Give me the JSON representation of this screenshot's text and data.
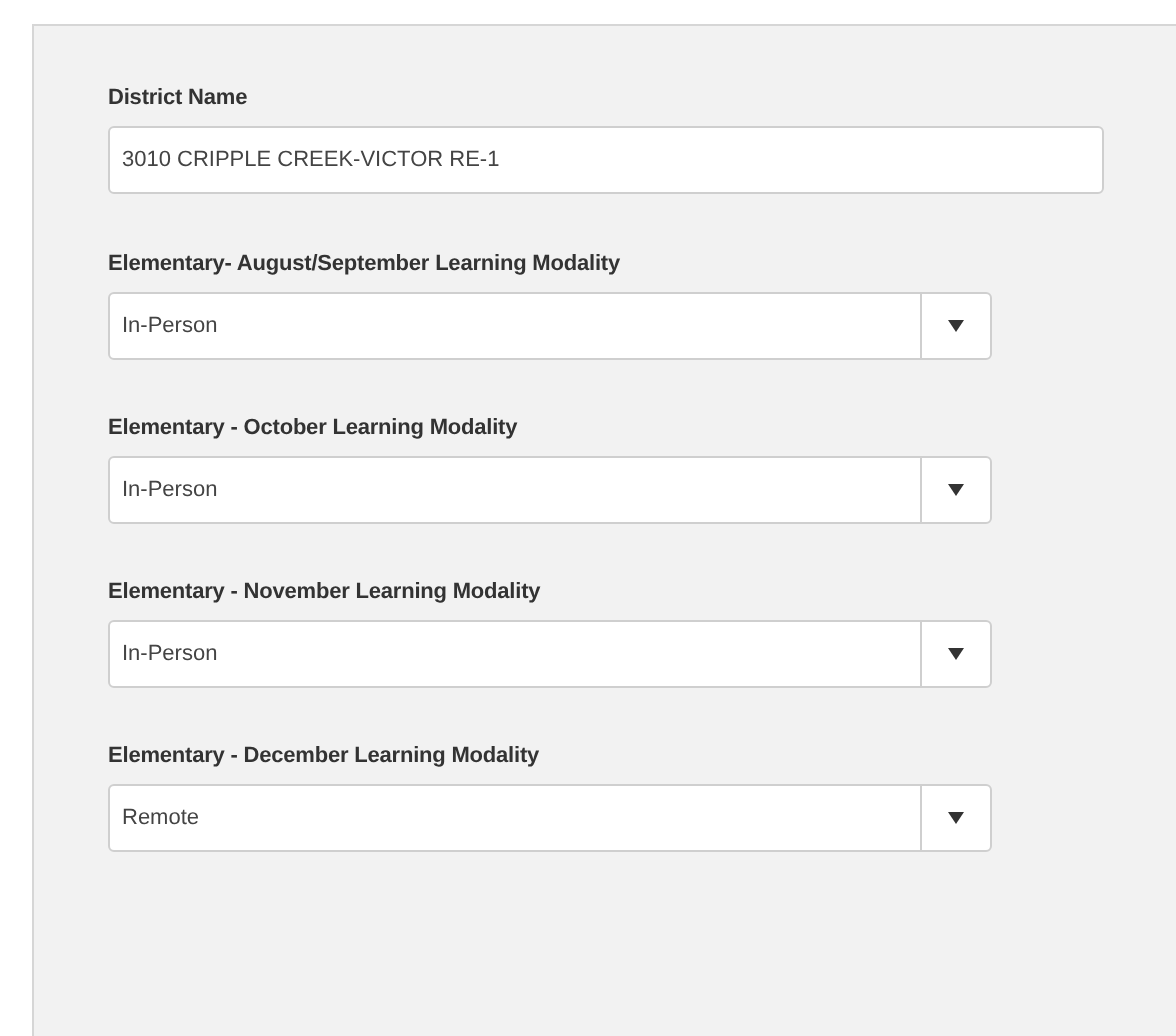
{
  "fields": [
    {
      "kind": "text",
      "label": "District Name",
      "value": "3010 CRIPPLE CREEK-VICTOR RE-1"
    },
    {
      "kind": "select",
      "label": "Elementary- August/September Learning Modality",
      "value": "In-Person"
    },
    {
      "kind": "select",
      "label": "Elementary - October Learning Modality",
      "value": "In-Person"
    },
    {
      "kind": "select",
      "label": "Elementary - November Learning Modality",
      "value": "In-Person"
    },
    {
      "kind": "select",
      "label": "Elementary - December Learning Modality",
      "value": "Remote"
    }
  ]
}
